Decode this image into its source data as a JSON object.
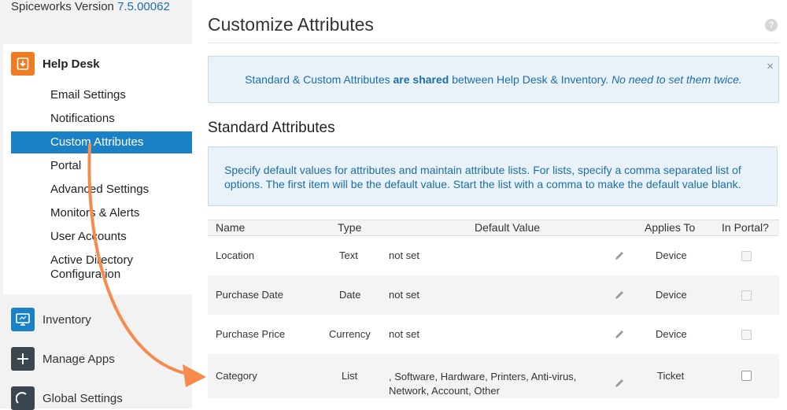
{
  "app": {
    "version_prefix": "Spiceworks Version ",
    "version_number": "7.5.00062"
  },
  "sidebar": {
    "section_title": "Help Desk",
    "items": [
      {
        "label": "Email Settings"
      },
      {
        "label": "Notifications"
      },
      {
        "label": "Custom Attributes",
        "active": true
      },
      {
        "label": "Portal"
      },
      {
        "label": "Advanced Settings"
      },
      {
        "label": "Monitors & Alerts"
      },
      {
        "label": "User Accounts"
      },
      {
        "label": "Active Directory"
      },
      {
        "label": "Configuration"
      }
    ],
    "bottom_items": [
      {
        "label": "Inventory",
        "icon": "monitor-icon",
        "color": "#1a82c4"
      },
      {
        "label": "Manage Apps",
        "icon": "plus-icon",
        "color": "#3b4650"
      },
      {
        "label": "Global Settings",
        "icon": "gauge-icon",
        "color": "#3b4650"
      }
    ]
  },
  "main": {
    "title": "Customize Attributes",
    "help_symbol": "?",
    "info": {
      "part1": "Standard & Custom Attributes ",
      "bold": "are shared",
      "part2": " between Help Desk & Inventory. ",
      "italic": "No need to set them twice.",
      "close_symbol": "×"
    },
    "section_title": "Standard Attributes",
    "description": "Specify default values for attributes and maintain attribute lists. For lists, specify a comma separated list of options. The first item will be the default value. Start the list with a comma to make the default value blank.",
    "table": {
      "columns": [
        "Name",
        "Type",
        "Default Value",
        "Applies To",
        "In Portal?"
      ],
      "rows": [
        {
          "name": "Location",
          "type": "Text",
          "default_value": "not set",
          "applies_to": "Device",
          "in_portal": false
        },
        {
          "name": "Purchase Date",
          "type": "Date",
          "default_value": "not set",
          "applies_to": "Device",
          "in_portal": false
        },
        {
          "name": "Purchase Price",
          "type": "Currency",
          "default_value": "not set",
          "applies_to": "Device",
          "in_portal": false
        },
        {
          "name": "Category",
          "type": "List",
          "default_value_line1": ", Software, Hardware, Printers, Anti-virus,",
          "default_value_line2": "Network, Account, Other",
          "applies_to": "Ticket",
          "in_portal": false
        }
      ]
    }
  },
  "colors": {
    "accent": "#1a82c4",
    "help_desk_icon": "#ef7c22",
    "annotation_arrow": "#f58b4c",
    "info_text": "#1a6fa8"
  }
}
